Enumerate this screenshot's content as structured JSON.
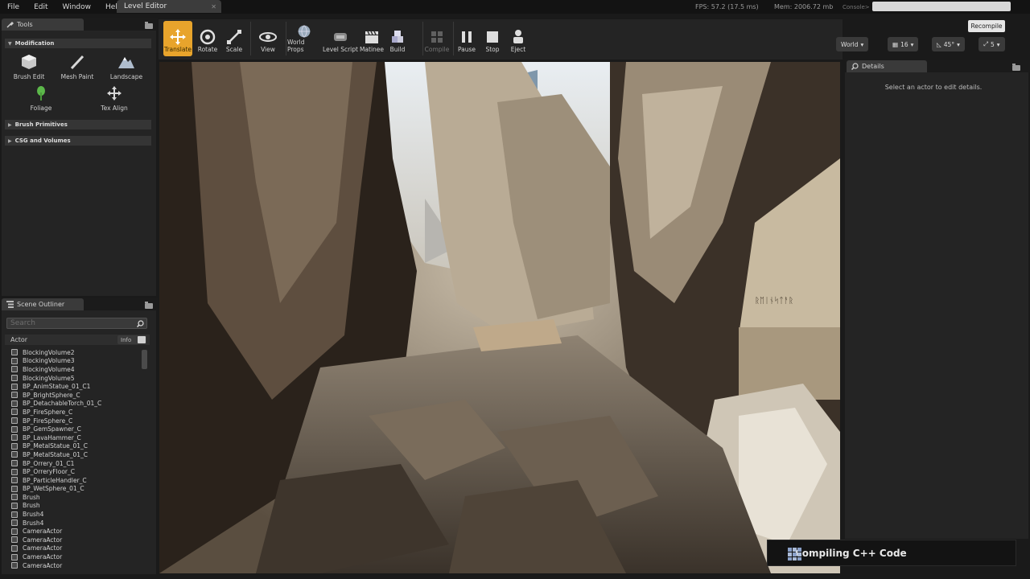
{
  "menubar": {
    "items": [
      "File",
      "Edit",
      "Window",
      "Help"
    ],
    "tab_title": "Level Editor",
    "fps": "FPS: 57.2",
    "frame_ms": "(17.5 ms)",
    "memory": "Mem: 2006.72 mb",
    "console_label": "Console>"
  },
  "tools_panel": {
    "tab_label": "Tools",
    "modification_label": "Modification",
    "tools": [
      "Brush Edit",
      "Mesh Paint",
      "Landscape",
      "Foliage",
      "Tex Align"
    ],
    "sections": [
      "Brush Primitives",
      "CSG and Volumes"
    ]
  },
  "outliner": {
    "tab_label": "Scene Outliner",
    "search_placeholder": "Search",
    "column_actor": "Actor",
    "column_info": "Info",
    "rows": [
      "BlockingVolume2",
      "BlockingVolume3",
      "BlockingVolume4",
      "BlockingVolume5",
      "BP_AnimStatue_01_C1",
      "BP_BrightSphere_C",
      "BP_DetachableTorch_01_C",
      "BP_FireSphere_C",
      "BP_FireSphere_C",
      "BP_GemSpawner_C",
      "BP_LavaHammer_C",
      "BP_MetalStatue_01_C",
      "BP_MetalStatue_01_C",
      "BP_Orrery_01_C1",
      "BP_OrreryFloor_C",
      "BP_ParticleHandler_C",
      "BP_WetSphere_01_C",
      "Brush",
      "Brush",
      "Brush4",
      "Brush4",
      "CameraActor",
      "CameraActor",
      "CameraActor",
      "CameraActor",
      "CameraActor"
    ]
  },
  "toolbar": {
    "buttons": [
      "Translate",
      "Rotate",
      "Scale",
      "View",
      "World Props",
      "Level Script",
      "Matinee",
      "Build",
      "Compile",
      "Pause",
      "Stop",
      "Eject"
    ]
  },
  "viewport_controls": {
    "world": "World",
    "grid_snap": "16",
    "rotation_snap": "45°",
    "scale_snap": "5",
    "recompile": "Recompile"
  },
  "details": {
    "tab_label": "Details",
    "hint": "Select an actor to edit details."
  },
  "notification": {
    "text": "Compiling C++ Code"
  },
  "colors": {
    "accent_active": "#e8a42c",
    "panel_bg": "#242424"
  }
}
